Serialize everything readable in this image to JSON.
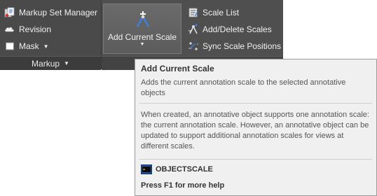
{
  "markup_panel": {
    "items": [
      {
        "label": "Markup Set Manager",
        "icon": "markup-set-manager-icon"
      },
      {
        "label": "Revision",
        "icon": "revision-cloud-icon"
      },
      {
        "label": "Mask",
        "icon": "mask-icon"
      }
    ],
    "panel_title": "Markup"
  },
  "scale_panel": {
    "big_button_label": "Add Current Scale",
    "items": [
      {
        "label": "Scale List",
        "icon": "scale-list-icon"
      },
      {
        "label": "Add/Delete Scales",
        "icon": "add-delete-scales-icon"
      },
      {
        "label": "Sync Scale Positions",
        "icon": "sync-scale-positions-icon"
      }
    ]
  },
  "tooltip": {
    "title": "Add Current Scale",
    "short_desc": "Adds the current annotation scale to the selected annotative objects",
    "long_desc": "When created, an annotative object supports one annotation scale: the current annotation scale. However, an annotative object can be updated to support additional annotation scales for views at different scales.",
    "command": "OBJECTSCALE",
    "help": "Press F1 for more help"
  },
  "colors": {
    "ribbon_bg": "#4e4e4e",
    "tooltip_bg": "#f0f0f0",
    "ribbon_text": "#f0f0f0"
  }
}
